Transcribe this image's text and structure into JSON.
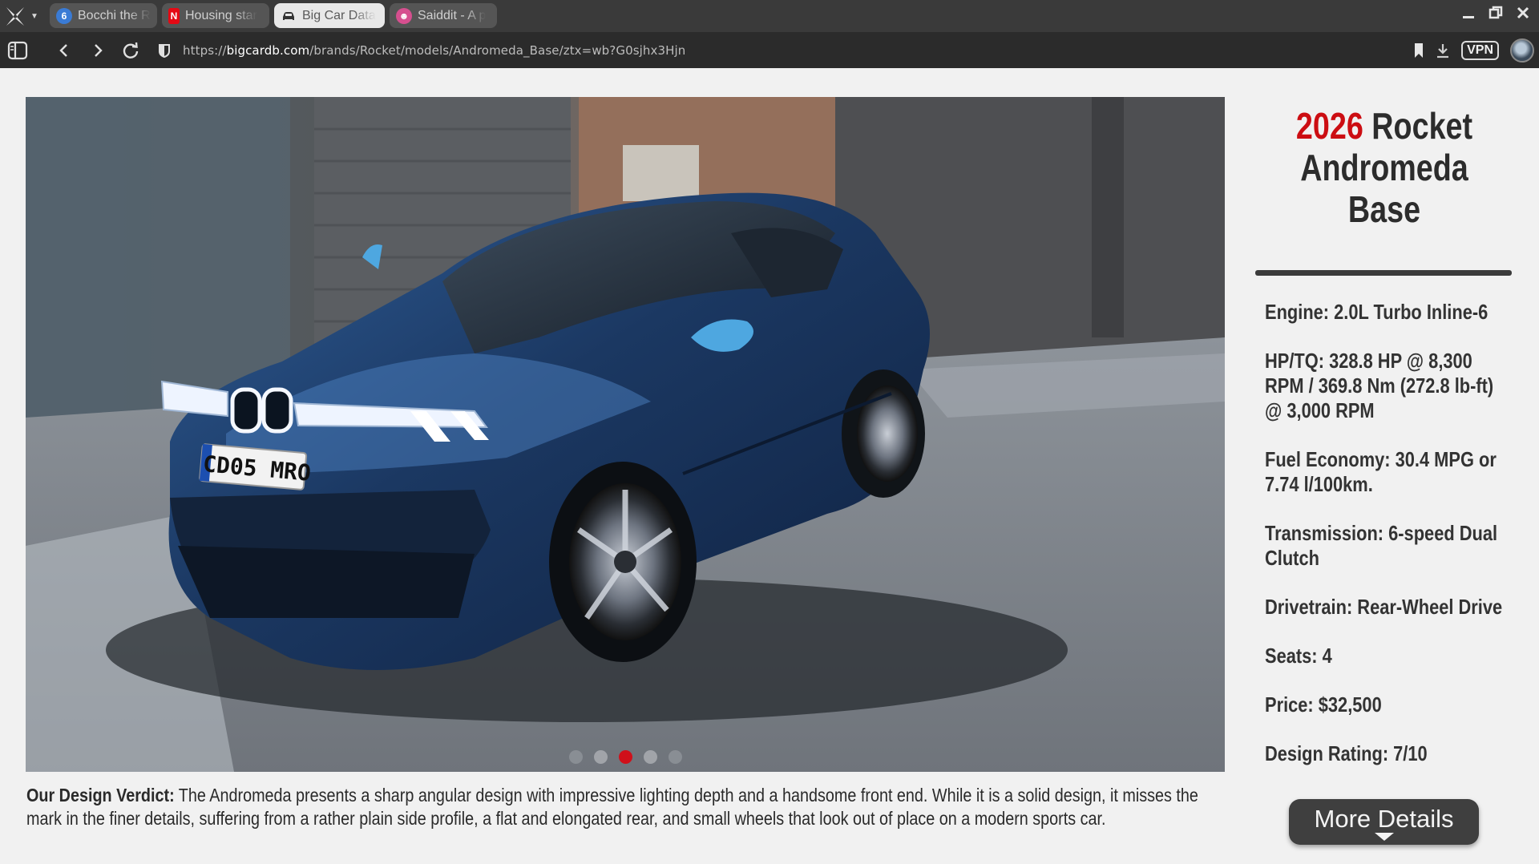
{
  "browser": {
    "tabs": [
      {
        "title": "Bocchi the R",
        "favicon": "bocchi-favicon",
        "color": "#3a7bd5",
        "glyph": "6"
      },
      {
        "title": "Housing star",
        "favicon": "netflix-favicon",
        "color": "#e50914",
        "glyph": "N"
      },
      {
        "title": "Big Car Data",
        "favicon": "car-favicon",
        "color": "#333333",
        "glyph": "🚘"
      },
      {
        "title": "Saiddit - A p",
        "favicon": "saiddit-favicon",
        "color": "#d64f8f",
        "glyph": "👾"
      }
    ],
    "active_tab_index": 2,
    "url": {
      "prefix": "https://",
      "domain": "bigcardb.com",
      "path": "/brands/Rocket/models/Andromeda_Base/ztx=wb?G0sjhx3Hjn"
    },
    "vpn_label": "VPN"
  },
  "page": {
    "title_year": "2026",
    "title_rest": " Rocket Andromeda Base",
    "specs": [
      "Engine: 2.0L Turbo Inline-6",
      "HP/TQ: 328.8 HP @ 8,300 RPM / 369.8 Nm (272.8 lb-ft) @ 3,000 RPM",
      "Fuel Economy: 30.4 MPG or 7.74 l/100km.",
      "Transmission: 6-speed Dual Clutch",
      "Drivetrain: Rear-Wheel Drive",
      "Seats: 4",
      "Price: $32,500",
      "Design Rating: 7/10"
    ],
    "gallery": {
      "slide_count": 5,
      "active_slide": 3,
      "license_plate": "CD05 MRO"
    },
    "verdict_label": "Our Design Verdict:",
    "verdict_text": " The Andromeda presents a sharp angular design with impressive lighting depth and a handsome front end. While it is a solid design, it misses the mark in the finer details, suffering from a rather plain side profile, a flat and elongated rear, and small wheels that look out of place on a modern sports car.",
    "more_button": "More Details"
  },
  "colors": {
    "accent_red": "#cc0d12",
    "car_body": "#1d3a66",
    "chrome_bg": "#3a3a3a"
  }
}
